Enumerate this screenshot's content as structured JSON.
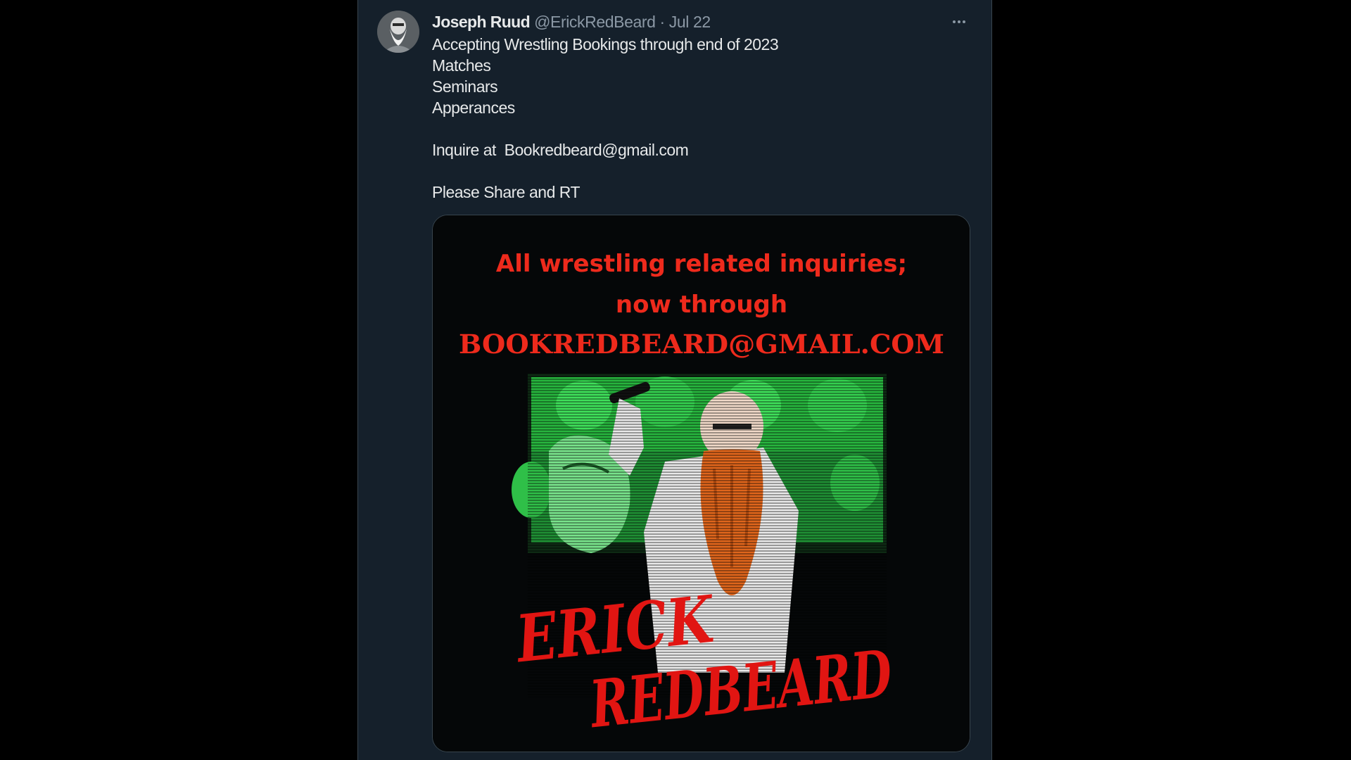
{
  "tweet": {
    "author_name": "Joseph Ruud",
    "handle": "@ErickRedBeard",
    "separator": "·",
    "date": "Jul 22",
    "more_icon": "more-horizontal-icon",
    "lines": [
      "Accepting Wrestling Bookings through end of 2023",
      "Matches",
      "Seminars",
      "Apperances",
      "",
      "Inquire at  Bookredbeard@gmail.com",
      "",
      "Please Share and RT"
    ]
  },
  "media": {
    "headline_line1": "All wrestling related inquiries;",
    "headline_line2": "now through",
    "email": "BOOKREDBEARD@GMAIL.COM",
    "brand_line1": "ERICK",
    "brand_line2": "REDBEARD"
  },
  "colors": {
    "page_bg": "#000000",
    "column_bg": "#15202b",
    "text_primary": "#e7e9ea",
    "text_secondary": "#8b98a5",
    "accent_red": "#ee2a1c",
    "accent_green": "#2fcf4a",
    "beard_orange": "#e0661c"
  }
}
